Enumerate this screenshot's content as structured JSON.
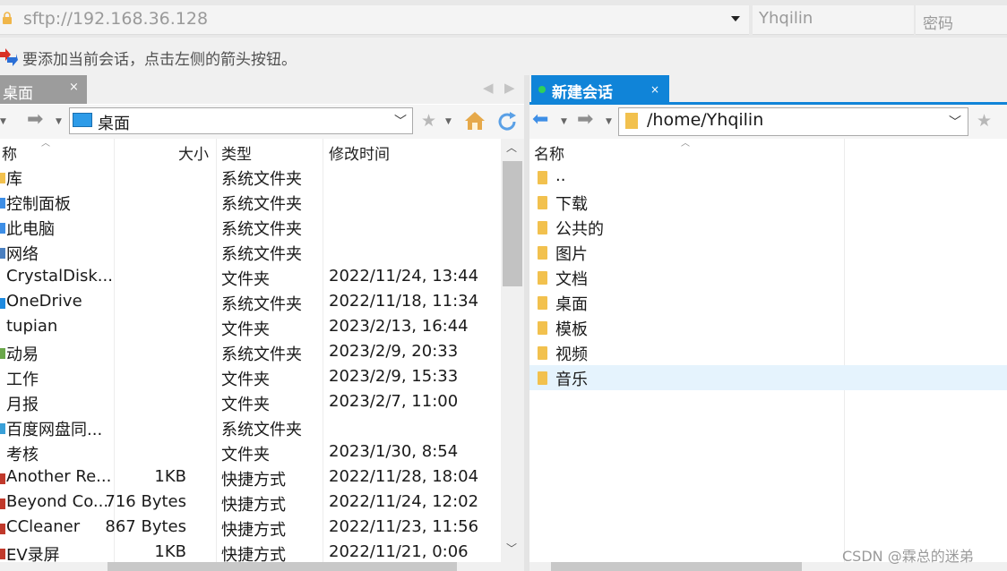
{
  "address_bar": {
    "address": "sftp://192.168.36.128",
    "username": "Yhqilin",
    "password_placeholder": "密码"
  },
  "hint_bar": {
    "text": "要添加当前会话，点击左侧的箭头按钮。"
  },
  "left_panel": {
    "tab_label": "桌面",
    "tab_close": "×",
    "path": "桌面",
    "columns": {
      "name": "称",
      "size": "大小",
      "type": "类型",
      "modified": "修改时间"
    },
    "rows": [
      {
        "name": "库",
        "size": "",
        "type": "系统文件夹",
        "modified": "",
        "icon": "library-icon"
      },
      {
        "name": "控制面板",
        "size": "",
        "type": "系统文件夹",
        "modified": "",
        "icon": "control-panel-icon"
      },
      {
        "name": "此电脑",
        "size": "",
        "type": "系统文件夹",
        "modified": "",
        "icon": "computer-icon"
      },
      {
        "name": "网络",
        "size": "",
        "type": "系统文件夹",
        "modified": "",
        "icon": "network-icon"
      },
      {
        "name": "CrystalDisk...",
        "size": "",
        "type": "文件夹",
        "modified": "2022/11/24, 13:44",
        "icon": "folder-icon"
      },
      {
        "name": "OneDrive",
        "size": "",
        "type": "系统文件夹",
        "modified": "2022/11/18, 11:34",
        "icon": "onedrive-icon"
      },
      {
        "name": "tupian",
        "size": "",
        "type": "文件夹",
        "modified": "2023/2/13, 16:44",
        "icon": "folder-icon"
      },
      {
        "name": "动易",
        "size": "",
        "type": "系统文件夹",
        "modified": "2023/2/9, 20:33",
        "icon": "system-folder-icon"
      },
      {
        "name": "工作",
        "size": "",
        "type": "文件夹",
        "modified": "2023/2/9, 15:33",
        "icon": "folder-icon"
      },
      {
        "name": "月报",
        "size": "",
        "type": "文件夹",
        "modified": "2023/2/7, 11:00",
        "icon": "folder-icon"
      },
      {
        "name": "百度网盘同...",
        "size": "",
        "type": "系统文件夹",
        "modified": "",
        "icon": "baidu-sync-icon"
      },
      {
        "name": "考核",
        "size": "",
        "type": "文件夹",
        "modified": "2023/1/30, 8:54",
        "icon": "folder-icon"
      },
      {
        "name": "Another Re...",
        "size": "1KB",
        "type": "快捷方式",
        "modified": "2022/11/28, 18:04",
        "icon": "app-shortcut-icon"
      },
      {
        "name": "Beyond Co...",
        "size": "716 Bytes",
        "type": "快捷方式",
        "modified": "2022/11/24, 12:02",
        "icon": "app-shortcut-icon"
      },
      {
        "name": "CCleaner",
        "size": "867 Bytes",
        "type": "快捷方式",
        "modified": "2022/11/23, 11:56",
        "icon": "app-shortcut-icon"
      },
      {
        "name": "EV录屏",
        "size": "1KB",
        "type": "快捷方式",
        "modified": "2022/11/21, 0:06",
        "icon": "app-shortcut-icon"
      }
    ]
  },
  "right_panel": {
    "tab_label": "新建会话",
    "tab_close": "×",
    "path": "/home/Yhqilin",
    "columns": {
      "name": "名称"
    },
    "rows": [
      {
        "name": ".."
      },
      {
        "name": "下载"
      },
      {
        "name": "公共的"
      },
      {
        "name": "图片"
      },
      {
        "name": "文档"
      },
      {
        "name": "桌面"
      },
      {
        "name": "模板"
      },
      {
        "name": "视频"
      },
      {
        "name": "音乐",
        "selected": true
      }
    ]
  },
  "watermark": "CSDN @霖总的迷弟",
  "colors": {
    "accent": "#1084d8",
    "folder": "#f2c14e",
    "selection": "#e5f3fd",
    "inactive_tab": "#9c9c9c"
  }
}
